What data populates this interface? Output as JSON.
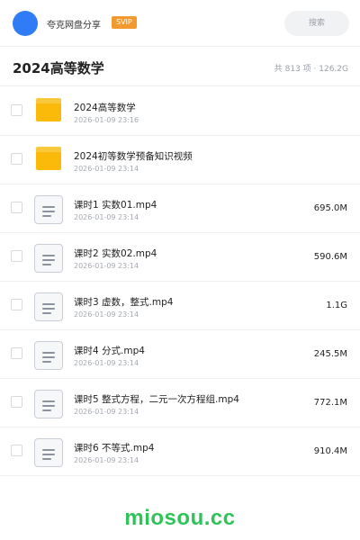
{
  "header": {
    "username": "夸克网盘分享",
    "badge": "SVIP",
    "search_label": "搜索",
    "accent": "#2f7cf6",
    "badge_color": "#f29a2e"
  },
  "folder": {
    "title": "2024高等数学",
    "summary": "共 813 项 · 126.2G"
  },
  "items": [
    {
      "type": "folder",
      "icon": "folder-icon",
      "name": "2024高等数学",
      "date": "2026-01-09 23:16",
      "size": ""
    },
    {
      "type": "folder",
      "icon": "folder-icon",
      "name": "2024初等数学预备知识视频",
      "date": "2026-01-09 23:14",
      "size": ""
    },
    {
      "type": "file",
      "icon": "video-file-icon",
      "name": "课时1   实数01.mp4",
      "date": "2026-01-09 23:14",
      "size": "695.0M"
    },
    {
      "type": "file",
      "icon": "video-file-icon",
      "name": "课时2 实数02.mp4",
      "date": "2026-01-09 23:14",
      "size": "590.6M"
    },
    {
      "type": "file",
      "icon": "video-file-icon",
      "name": "课时3   虚数，整式.mp4",
      "date": "2026-01-09 23:14",
      "size": "1.1G"
    },
    {
      "type": "file",
      "icon": "video-file-icon",
      "name": "课时4 分式.mp4",
      "date": "2026-01-09 23:14",
      "size": "245.5M"
    },
    {
      "type": "file",
      "icon": "video-file-icon",
      "name": "课时5   整式方程，二元一次方程组.mp4",
      "date": "2026-01-09 23:14",
      "size": "772.1M"
    },
    {
      "type": "file",
      "icon": "video-file-icon",
      "name": "课时6   不等式.mp4",
      "date": "2026-01-09 23:14",
      "size": "910.4M"
    }
  ],
  "watermark": "miosou.cc"
}
